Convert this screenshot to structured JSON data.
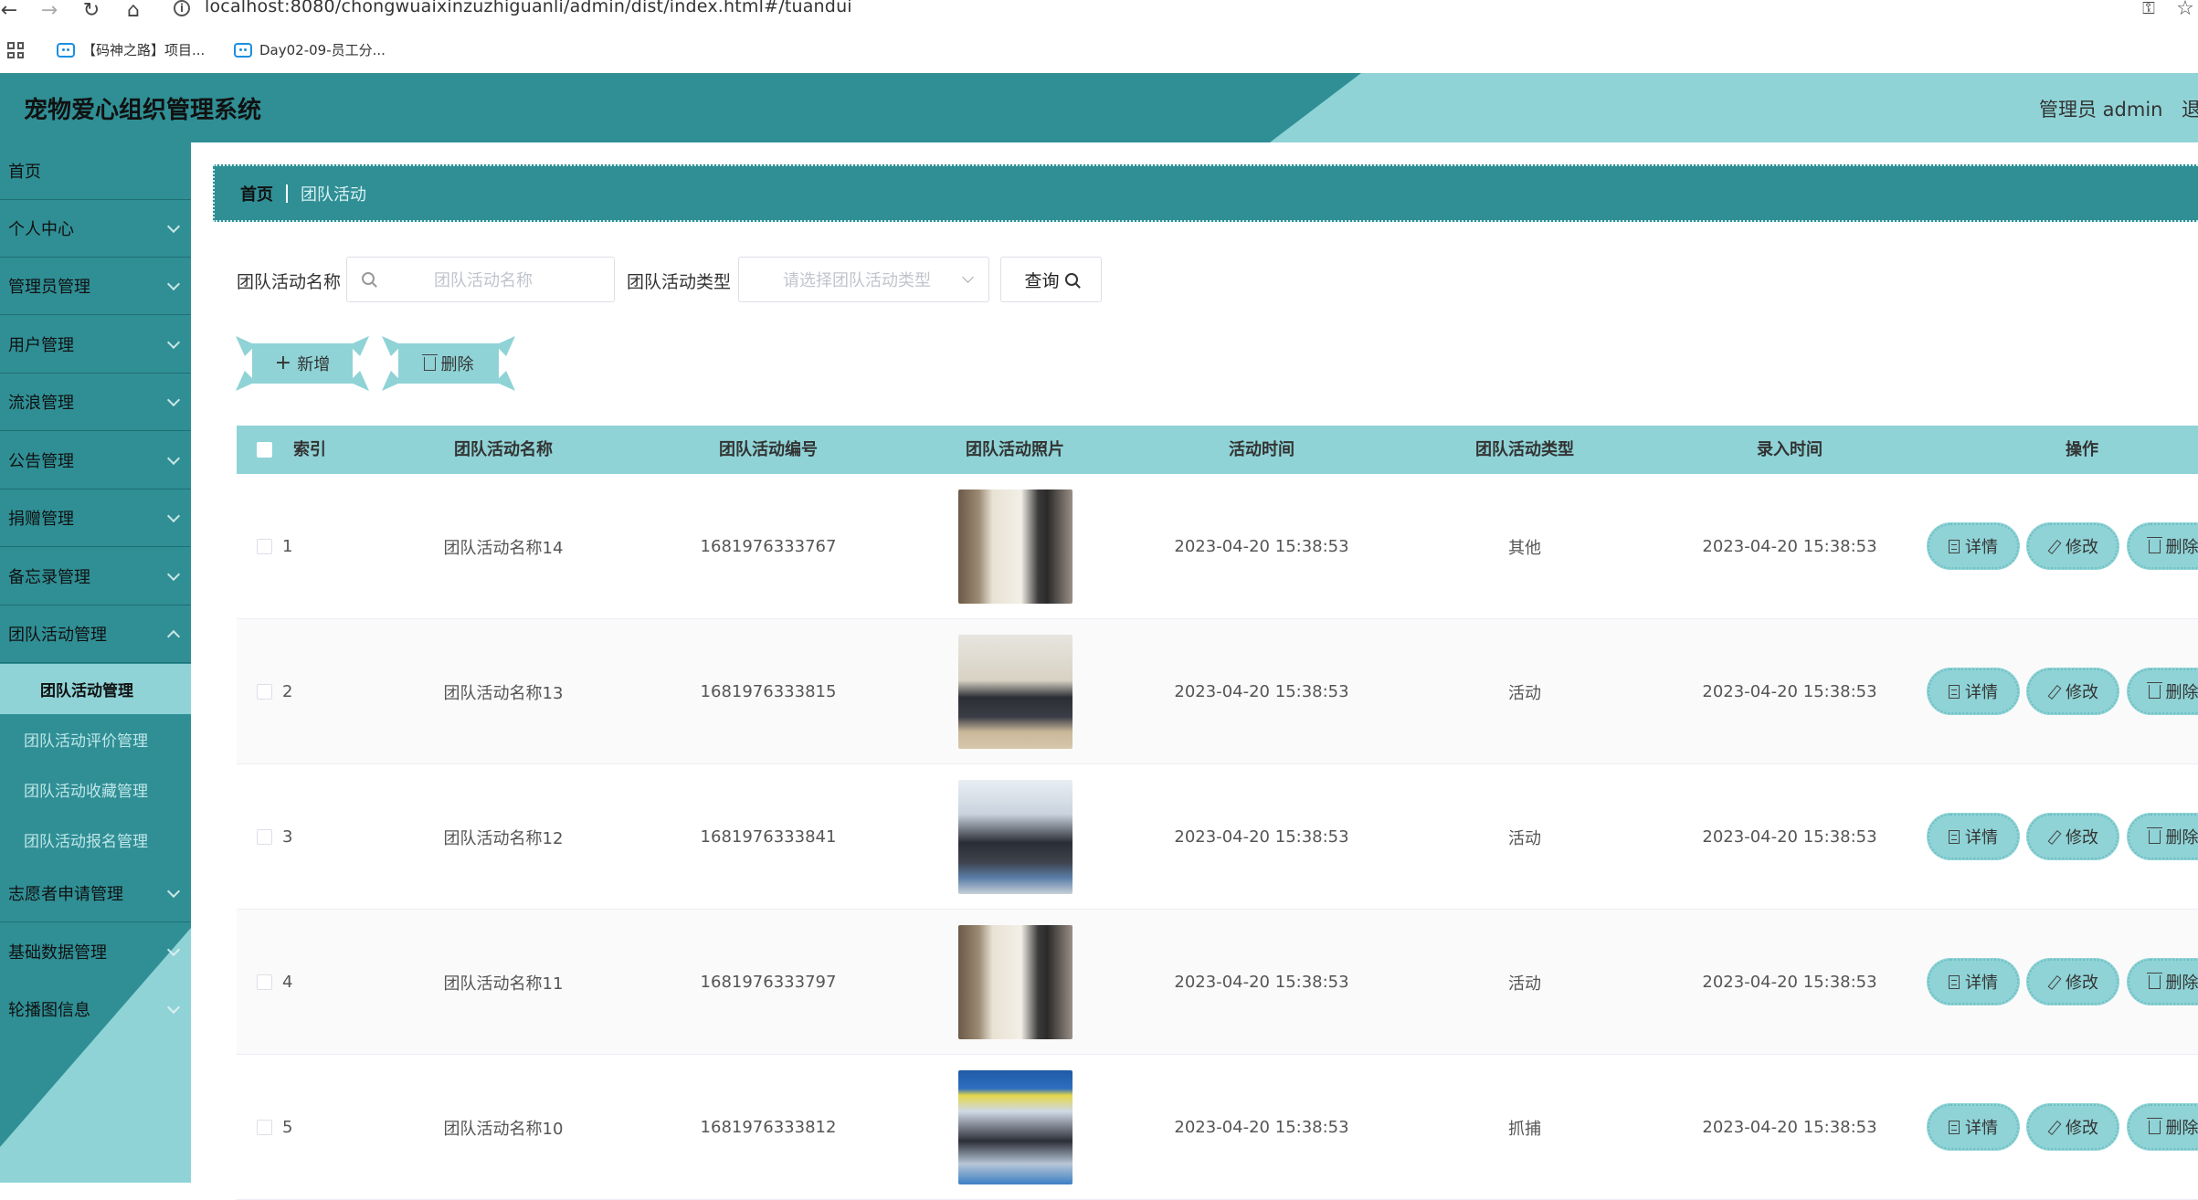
{
  "browser": {
    "url": "localhost:8080/chongwuaixinzuzhiguanli/admin/dist/index.html#/tuandui",
    "bookmarks": [
      "【码神之路】项目...",
      "Day02-09-员工分..."
    ]
  },
  "header": {
    "title": "宠物爱心组织管理系统",
    "admin_label": "管理员 admin",
    "logout": "退"
  },
  "sidebar": {
    "items": [
      {
        "label": "首页"
      },
      {
        "label": "个人中心"
      },
      {
        "label": "管理员管理"
      },
      {
        "label": "用户管理"
      },
      {
        "label": "流浪管理"
      },
      {
        "label": "公告管理"
      },
      {
        "label": "捐赠管理"
      },
      {
        "label": "备忘录管理"
      },
      {
        "label": "团队活动管理"
      }
    ],
    "sub_items": [
      "团队活动管理",
      "团队活动评价管理",
      "团队活动收藏管理",
      "团队活动报名管理"
    ],
    "items_after": [
      {
        "label": "志愿者申请管理"
      },
      {
        "label": "基础数据管理"
      },
      {
        "label": "轮播图信息"
      }
    ]
  },
  "breadcrumb": {
    "home": "首页",
    "current": "团队活动"
  },
  "search": {
    "name_label": "团队活动名称",
    "name_placeholder": "团队活动名称",
    "type_label": "团队活动类型",
    "type_placeholder": "请选择团队活动类型",
    "query_button": "查询"
  },
  "actions": {
    "add": "新增",
    "delete": "删除"
  },
  "table": {
    "columns": [
      "索引",
      "团队活动名称",
      "团队活动编号",
      "团队活动照片",
      "活动时间",
      "团队活动类型",
      "录入时间",
      "操作"
    ],
    "rows": [
      {
        "index": "1",
        "name": "团队活动名称14",
        "code": "1681976333767",
        "time": "2023-04-20 15:38:53",
        "type": "其他",
        "created": "2023-04-20 15:38:53"
      },
      {
        "index": "2",
        "name": "团队活动名称13",
        "code": "1681976333815",
        "time": "2023-04-20 15:38:53",
        "type": "活动",
        "created": "2023-04-20 15:38:53"
      },
      {
        "index": "3",
        "name": "团队活动名称12",
        "code": "1681976333841",
        "time": "2023-04-20 15:38:53",
        "type": "活动",
        "created": "2023-04-20 15:38:53"
      },
      {
        "index": "4",
        "name": "团队活动名称11",
        "code": "1681976333797",
        "time": "2023-04-20 15:38:53",
        "type": "活动",
        "created": "2023-04-20 15:38:53"
      },
      {
        "index": "5",
        "name": "团队活动名称10",
        "code": "1681976333812",
        "time": "2023-04-20 15:38:53",
        "type": "抓捕",
        "created": "2023-04-20 15:38:53"
      }
    ],
    "op_labels": {
      "detail": "详情",
      "edit": "修改",
      "delete": "删除"
    }
  },
  "colors": {
    "primary": "#2f8f95",
    "accent": "#8fd3d6"
  }
}
